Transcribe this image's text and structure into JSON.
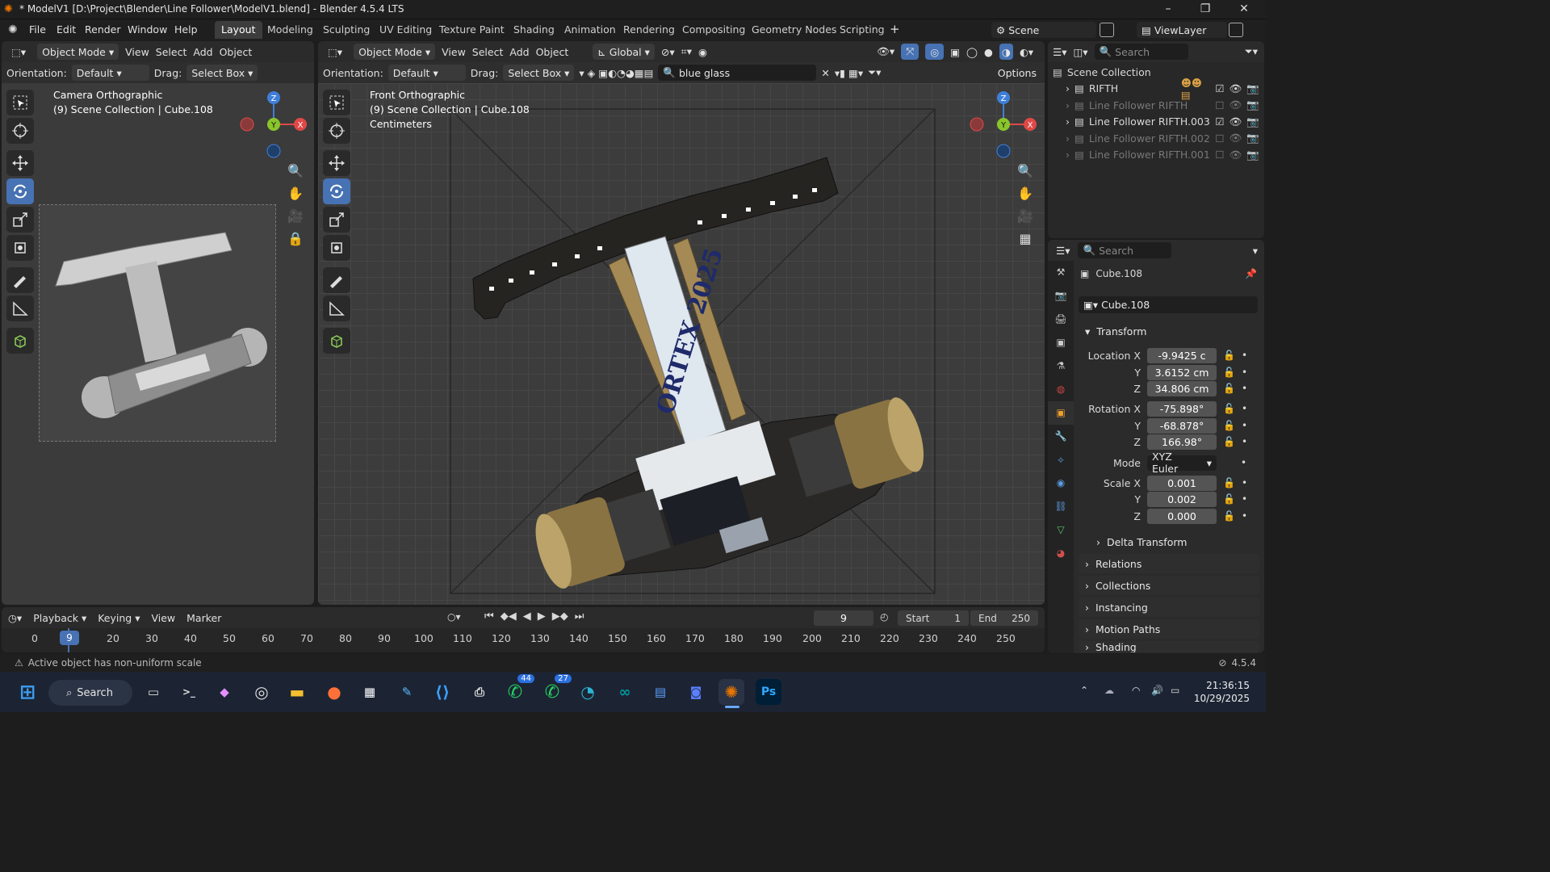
{
  "window": {
    "title": "* ModelV1 [D:\\Project\\Blender\\Line Follower\\ModelV1.blend] - Blender 4.5.4 LTS"
  },
  "menu": [
    "File",
    "Edit",
    "Render",
    "Window",
    "Help"
  ],
  "workspaces": [
    "Layout",
    "Modeling",
    "Sculpting",
    "UV Editing",
    "Texture Paint",
    "Shading",
    "Animation",
    "Rendering",
    "Compositing",
    "Geometry Nodes",
    "Scripting"
  ],
  "active_workspace": "Layout",
  "scene": "Scene",
  "view_layer": "ViewLayer",
  "left_viewport": {
    "mode": "Object Mode",
    "menus": [
      "View",
      "Select",
      "Add",
      "Object"
    ],
    "orientation_label": "Orientation:",
    "orientation": "Default",
    "drag_label": "Drag:",
    "drag": "Select Box",
    "view_name": "Camera Orthographic",
    "context": "(9) Scene Collection | Cube.108"
  },
  "main_viewport": {
    "mode": "Object Mode",
    "menus": [
      "View",
      "Select",
      "Add",
      "Object"
    ],
    "transform": "Global",
    "orientation_label": "Orientation:",
    "orientation": "Default",
    "drag_label": "Drag:",
    "drag": "Select Box",
    "search_value": "blue glass",
    "options": "Options",
    "view_name": "Front Orthographic",
    "context": "(9) Scene Collection | Cube.108",
    "units": "Centimeters",
    "label_text": "ORTEX 2025"
  },
  "outliner": {
    "search_placeholder": "Search",
    "root": "Scene Collection",
    "items": [
      {
        "name": "RIFTH",
        "checked": true,
        "visible": true
      },
      {
        "name": "Line Follower RIFTH",
        "checked": false,
        "visible": false
      },
      {
        "name": "Line Follower RIFTH.003",
        "checked": true,
        "visible": true
      },
      {
        "name": "Line Follower RIFTH.002",
        "checked": false,
        "visible": false
      },
      {
        "name": "Line Follower RIFTH.001",
        "checked": false,
        "visible": false
      }
    ]
  },
  "properties": {
    "search_placeholder": "Search",
    "object_name": "Cube.108",
    "data_name": "Cube.108",
    "transform_label": "Transform",
    "location": {
      "label": "Location X",
      "x": "-9.9425 c",
      "y": "3.6152 cm",
      "z": "34.806 cm"
    },
    "rotation": {
      "label": "Rotation X",
      "x": "-75.898°",
      "y": "-68.878°",
      "z": "166.98°"
    },
    "mode_label": "Mode",
    "mode": "XYZ Euler",
    "scale": {
      "label": "Scale X",
      "x": "0.001",
      "y": "0.002",
      "z": "0.000"
    },
    "axis_y": "Y",
    "axis_z": "Z",
    "sections": [
      "Delta Transform",
      "Relations",
      "Collections",
      "Instancing",
      "Motion Paths",
      "Shading"
    ]
  },
  "timeline": {
    "menus": [
      "Playback",
      "Keying",
      "View",
      "Marker"
    ],
    "current_frame": "9",
    "start_label": "Start",
    "start": "1",
    "end_label": "End",
    "end": "250",
    "ticks": [
      "0",
      "20",
      "30",
      "40",
      "50",
      "60",
      "70",
      "80",
      "90",
      "100",
      "110",
      "120",
      "130",
      "140",
      "150",
      "160",
      "170",
      "180",
      "190",
      "200",
      "210",
      "220",
      "230",
      "240",
      "250"
    ]
  },
  "status": {
    "message": "Active object has non-uniform scale",
    "version": "4.5.4"
  },
  "taskbar": {
    "search": "Search",
    "time": "21:36:15",
    "date": "10/29/2025",
    "badges": {
      "whatsapp": "44",
      "whatsapp_beta": "27"
    }
  },
  "colors": {
    "accent": "#4772b3",
    "x_axis": "#e04848",
    "y_axis": "#8ac52a",
    "z_axis": "#3f7fd9"
  }
}
